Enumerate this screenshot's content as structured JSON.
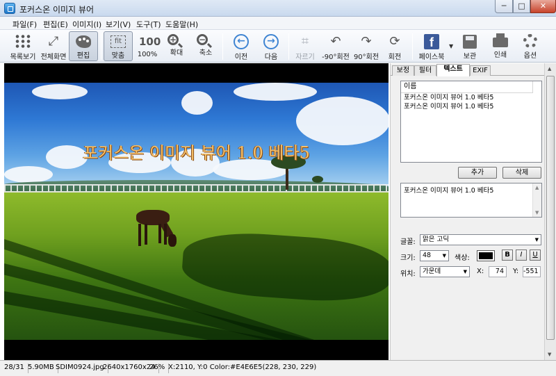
{
  "window": {
    "title": "포커스온 이미지 뷰어",
    "controls": {
      "minimize": "─",
      "maximize": "□",
      "close": "✕"
    }
  },
  "menu": [
    "파일(F)",
    "편집(E)",
    "이미지(I)",
    "보기(V)",
    "도구(T)",
    "도움말(H)"
  ],
  "toolbar": {
    "list_view": "목록보기",
    "fullscreen": "전체화면",
    "edit": "편집",
    "fit": "맞춤",
    "fit_icon_text": "fit",
    "zoom100": "100%",
    "zoom100_icon_text": "100",
    "zoom_in": "확대",
    "zoom_out": "축소",
    "prev": "이전",
    "next": "다음",
    "crop": "자르기",
    "rotate_ccw": "-90°회전",
    "rotate_cw": "90°회전",
    "rotate": "회전",
    "facebook": "페이스북",
    "facebook_icon_text": "f",
    "save": "보관",
    "print": "인쇄",
    "options": "옵션"
  },
  "image": {
    "overlay_text": "포커스온 이미지 뷰어 1.0 베타5"
  },
  "panel": {
    "tabs": [
      "보정",
      "필터",
      "텍스트",
      "EXIF"
    ],
    "active_tab": "텍스트",
    "list_header": "이름",
    "list_items": [
      "포커스온 이미지 뷰어 1.0 베타5",
      "포커스온 이미지 뷰어 1.0 베타5"
    ],
    "add_button": "추가",
    "delete_button": "삭제",
    "text_value": "포커스온 이미지 뷰어 1.0 베타5",
    "font_label": "글꼴:",
    "font_value": "맑은 고딕",
    "size_label": "크기:",
    "size_value": "48",
    "color_label": "색상:",
    "text_color": "#000000",
    "bold": "B",
    "italic": "I",
    "underline": "U",
    "position_label": "위치:",
    "position_value": "가운데",
    "x_label": "X:",
    "x_value": "74",
    "y_label": "Y:",
    "y_value": "-551"
  },
  "status": {
    "index": "28/31",
    "filesize": "5.90MB",
    "filename": "SDIM0924.jpg",
    "dimensions": "2640x1760x24",
    "zoom": "26%",
    "pixel_info": "X:2110, Y:0 Color:#E4E6E5(228, 230, 229)"
  }
}
